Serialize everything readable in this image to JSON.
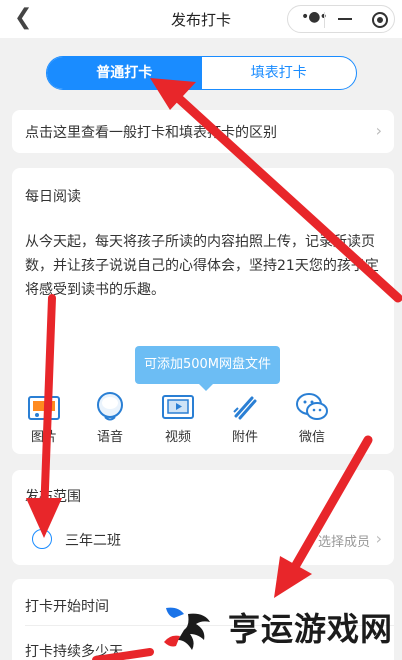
{
  "header": {
    "title": "发布打卡",
    "back_icon": "chevron-left-icon",
    "more_icon": "more-dots-icon",
    "minimize_icon": "minimize-icon",
    "close_icon": "target-close-icon"
  },
  "tabs": [
    {
      "label": "普通打卡",
      "active": true
    },
    {
      "label": "填表打卡",
      "active": false
    }
  ],
  "info_row": {
    "text": "点击这里查看一般打卡和填表打卡的区别"
  },
  "content": {
    "title": "每日阅读",
    "body": "从今天起，每天将孩子所读的内容拍照上传，记录所读页数，并让孩子说说自己的心得体会，坚持21天您的孩子定将感受到读书的乐趣。"
  },
  "tooltip": {
    "text": "可添加500M网盘文件"
  },
  "media_buttons": [
    {
      "label": "图片",
      "icon": "image-icon"
    },
    {
      "label": "语音",
      "icon": "microphone-icon"
    },
    {
      "label": "视频",
      "icon": "video-icon"
    },
    {
      "label": "附件",
      "icon": "paperclip-icon"
    },
    {
      "label": "微信",
      "icon": "wechat-icon"
    }
  ],
  "scope": {
    "title": "发布范围",
    "class_name": "三年二班",
    "select_label": "选择成员"
  },
  "time": {
    "start_label": "打卡开始时间",
    "duration_label": "打卡持续多少天"
  },
  "watermark": {
    "text": "亨运游戏网"
  },
  "colors": {
    "accent": "#1a8cff",
    "tooltip": "#6cbdf4",
    "arrow": "#e8262a",
    "background": "#f1f1f1"
  }
}
